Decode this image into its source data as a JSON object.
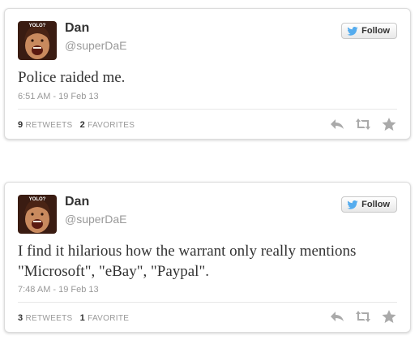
{
  "colors": {
    "twitter_blue": "#55acee",
    "text": "#333333",
    "muted": "#999999",
    "action_grey": "#aaaaaa"
  },
  "tweets": [
    {
      "user": {
        "name": "Dan",
        "handle": "@superDaE",
        "avatar_caption": "YOLO?"
      },
      "follow_label": "Follow",
      "text": "Police raided me.",
      "timestamp": "6:51 AM - 19 Feb 13",
      "retweets": {
        "count": "9",
        "label": "Retweets"
      },
      "favorites": {
        "count": "2",
        "label": "Favorites"
      },
      "actions": [
        "reply-icon",
        "retweet-icon",
        "favorite-icon"
      ]
    },
    {
      "user": {
        "name": "Dan",
        "handle": "@superDaE",
        "avatar_caption": "YOLO?"
      },
      "follow_label": "Follow",
      "text": "I find it hilarious how the warrant only really mentions \"Microsoft\", \"eBay\", \"Paypal\".",
      "timestamp": "7:48 AM - 19 Feb 13",
      "retweets": {
        "count": "3",
        "label": "Retweets"
      },
      "favorites": {
        "count": "1",
        "label": "Favorite"
      },
      "actions": [
        "reply-icon",
        "retweet-icon",
        "favorite-icon"
      ]
    }
  ]
}
